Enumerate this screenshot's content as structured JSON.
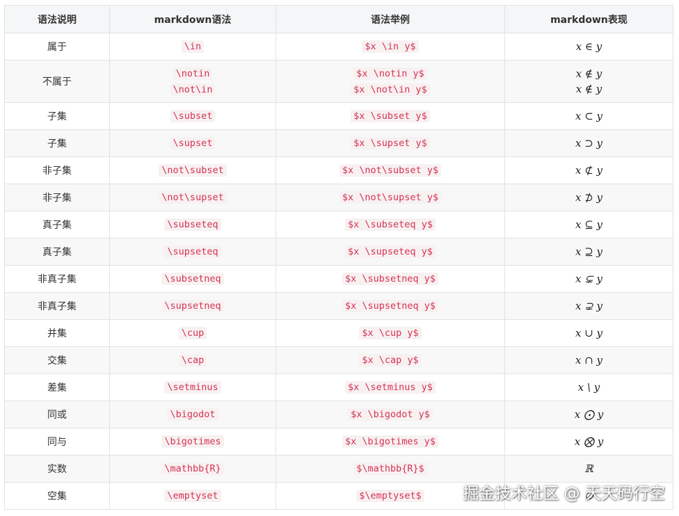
{
  "headers": [
    "语法说明",
    "markdown语法",
    "语法举例",
    "markdown表现"
  ],
  "rows": [
    {
      "desc": "属于",
      "syntax": [
        "\\in"
      ],
      "example": [
        "$x \\in y$"
      ],
      "render": [
        "x ∈ y"
      ]
    },
    {
      "desc": "不属于",
      "syntax": [
        "\\notin",
        "\\not\\in"
      ],
      "example": [
        "$x \\notin y$",
        "$x \\not\\in y$"
      ],
      "render": [
        "x ∉ y",
        "x ∉ y"
      ]
    },
    {
      "desc": "子集",
      "syntax": [
        "\\subset"
      ],
      "example": [
        "$x \\subset y$"
      ],
      "render": [
        "x ⊂ y"
      ]
    },
    {
      "desc": "子集",
      "syntax": [
        "\\supset"
      ],
      "example": [
        "$x \\supset y$"
      ],
      "render": [
        "x ⊃ y"
      ]
    },
    {
      "desc": "非子集",
      "syntax": [
        "\\not\\subset"
      ],
      "example": [
        "$x \\not\\subset y$"
      ],
      "render": [
        "x ⊄ y"
      ]
    },
    {
      "desc": "非子集",
      "syntax": [
        "\\not\\supset"
      ],
      "example": [
        "$x \\not\\supset y$"
      ],
      "render": [
        "x ⊅ y"
      ]
    },
    {
      "desc": "真子集",
      "syntax": [
        "\\subseteq"
      ],
      "example": [
        "$x \\subseteq y$"
      ],
      "render": [
        "x ⊆ y"
      ]
    },
    {
      "desc": "真子集",
      "syntax": [
        "\\supseteq"
      ],
      "example": [
        "$x \\supseteq y$"
      ],
      "render": [
        "x ⊇ y"
      ]
    },
    {
      "desc": "非真子集",
      "syntax": [
        "\\subsetneq"
      ],
      "example": [
        "$x \\subsetneq y$"
      ],
      "render": [
        "x ⊊ y"
      ]
    },
    {
      "desc": "非真子集",
      "syntax": [
        "\\supsetneq"
      ],
      "example": [
        "$x \\supsetneq y$"
      ],
      "render": [
        "x ⊋ y"
      ]
    },
    {
      "desc": "并集",
      "syntax": [
        "\\cup"
      ],
      "example": [
        "$x \\cup y$"
      ],
      "render": [
        "x ∪ y"
      ]
    },
    {
      "desc": "交集",
      "syntax": [
        "\\cap"
      ],
      "example": [
        "$x \\cap y$"
      ],
      "render": [
        "x ∩ y"
      ]
    },
    {
      "desc": "差集",
      "syntax": [
        "\\setminus"
      ],
      "example": [
        "$x \\setminus y$"
      ],
      "render": [
        "x \\ y"
      ]
    },
    {
      "desc": "同或",
      "syntax": [
        "\\bigodot"
      ],
      "example": [
        "$x \\bigodot y$"
      ],
      "render": [
        "x ⨀ y"
      ]
    },
    {
      "desc": "同与",
      "syntax": [
        "\\bigotimes"
      ],
      "example": [
        "$x \\bigotimes y$"
      ],
      "render": [
        "x ⨂ y"
      ]
    },
    {
      "desc": "实数",
      "syntax": [
        "\\mathbb{R}"
      ],
      "example": [
        "$\\mathbb{R}$"
      ],
      "render": [
        "ℝ"
      ]
    },
    {
      "desc": "空集",
      "syntax": [
        "\\emptyset"
      ],
      "example": [
        "$\\emptyset$"
      ],
      "render": [
        "∅"
      ]
    }
  ],
  "watermark": "掘金技术社区 @ 天天码行空",
  "colors": {
    "code_text": "#d63250",
    "code_bg": "#f7f1f2",
    "header_bg": "#f5f6f7",
    "border": "#e2e2e2"
  }
}
